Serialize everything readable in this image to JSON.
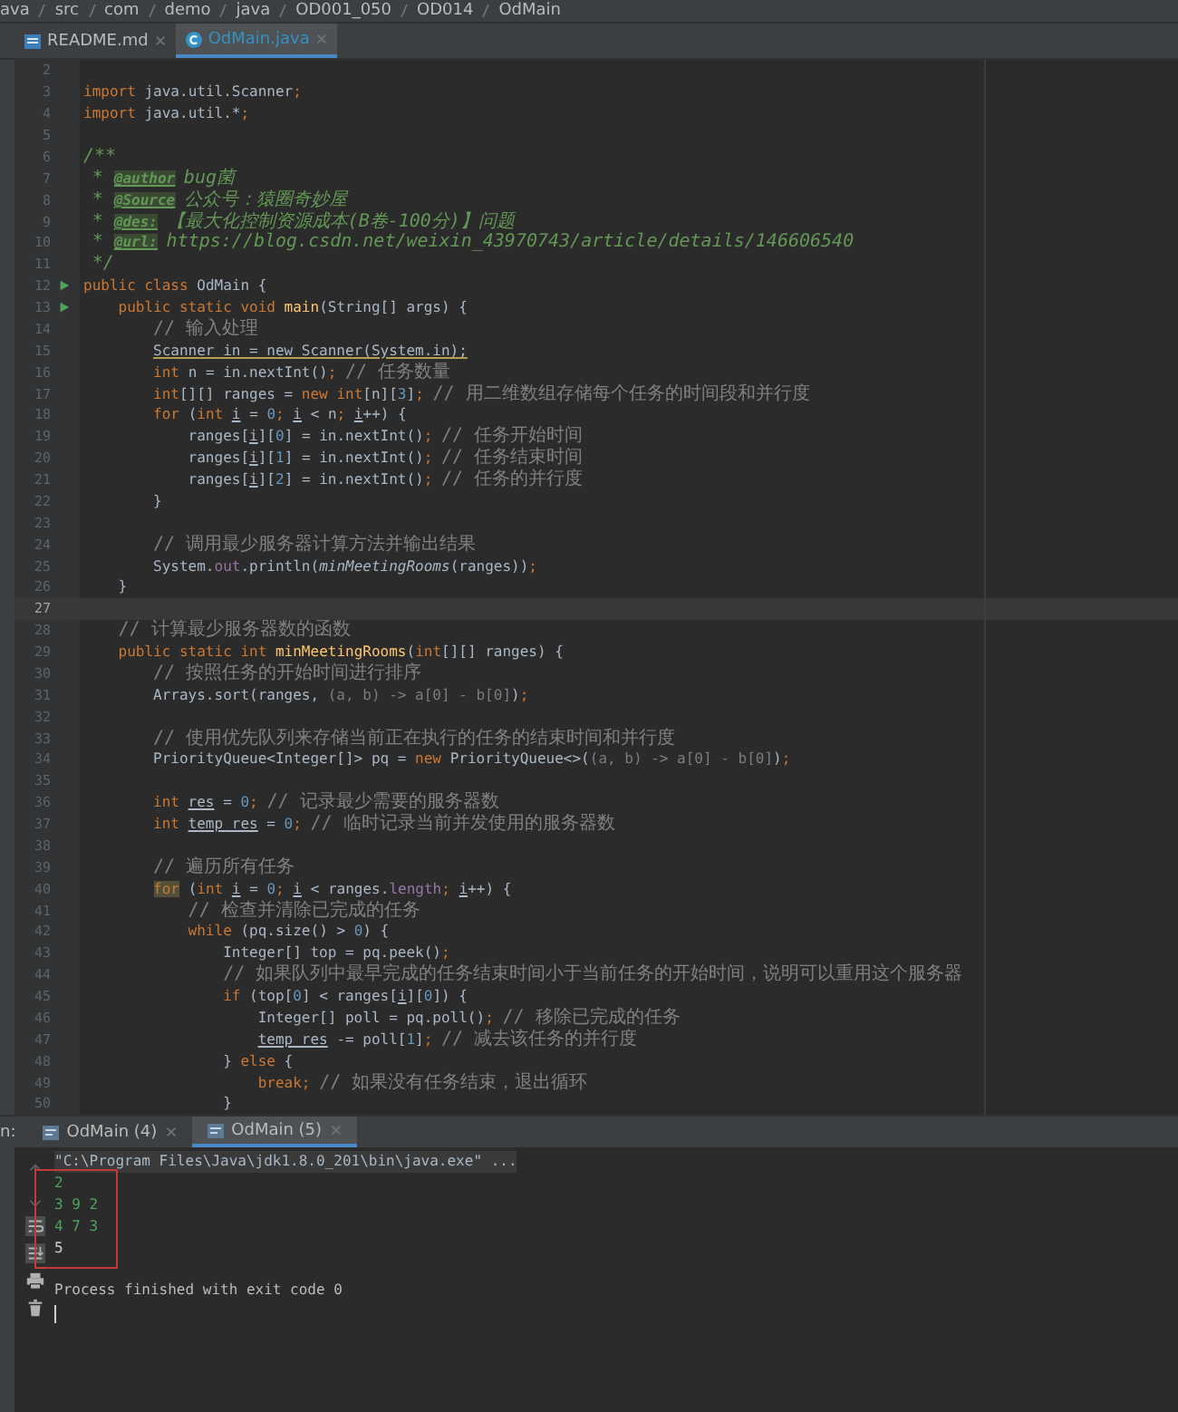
{
  "breadcrumb": [
    "ava",
    "src",
    "com",
    "demo",
    "java",
    "OD001_050",
    "OD014",
    "OdMain"
  ],
  "editor_tabs": [
    {
      "label": "README.md",
      "kind": "markdown",
      "selected": false
    },
    {
      "label": "OdMain.java",
      "kind": "java",
      "selected": true
    }
  ],
  "editor": {
    "lines": [
      {
        "number": "2",
        "current": false
      },
      {
        "number": "3",
        "current": false,
        "tokens": [
          {
            "kind": "kw",
            "text": "import"
          },
          {
            "kind": "plain",
            "text": " java.util.Scanner"
          },
          {
            "kind": "kw",
            "text": ";"
          }
        ]
      },
      {
        "number": "4",
        "current": false,
        "tokens": [
          {
            "kind": "kw",
            "text": "import"
          },
          {
            "kind": "plain",
            "text": " java.util.*"
          },
          {
            "kind": "kw",
            "text": ";"
          }
        ]
      },
      {
        "number": "5",
        "current": false
      },
      {
        "number": "6",
        "current": false,
        "tokens": [
          {
            "kind": "doc",
            "text": "/**"
          }
        ]
      },
      {
        "number": "7",
        "current": false,
        "tokens": [
          {
            "kind": "doc",
            "text": " * "
          },
          {
            "kind": "tag",
            "text": "@author"
          },
          {
            "kind": "doc",
            "text": " bug菌"
          }
        ]
      },
      {
        "number": "8",
        "current": false,
        "tokens": [
          {
            "kind": "doc",
            "text": " * "
          },
          {
            "kind": "tag",
            "text": "@Source"
          },
          {
            "kind": "doc",
            "text": " 公众号：猿圈奇妙屋"
          }
        ]
      },
      {
        "number": "9",
        "current": false,
        "tokens": [
          {
            "kind": "doc",
            "text": " * "
          },
          {
            "kind": "tag",
            "text": "@des:"
          },
          {
            "kind": "doc",
            "text": " 【最大化控制资源成本(B卷-100分)】问题"
          }
        ]
      },
      {
        "number": "10",
        "current": false,
        "tokens": [
          {
            "kind": "doc",
            "text": " * "
          },
          {
            "kind": "tag",
            "text": "@url:"
          },
          {
            "kind": "doc",
            "text": " https://blog.csdn.net/weixin_43970743/article/details/146606540"
          }
        ]
      },
      {
        "number": "11",
        "current": false,
        "tokens": [
          {
            "kind": "doc",
            "text": " */"
          }
        ]
      },
      {
        "number": "12",
        "current": false,
        "run": true,
        "tokens": [
          {
            "kind": "kw",
            "text": "public class"
          },
          {
            "kind": "plain",
            "text": " OdMain {"
          }
        ]
      },
      {
        "number": "13",
        "current": false,
        "run": true,
        "tokens": [
          {
            "kind": "kw",
            "text": "    public static void"
          },
          {
            "kind": "fn",
            "text": " main"
          },
          {
            "kind": "plain",
            "text": "(String[] args) {"
          }
        ]
      },
      {
        "number": "14",
        "current": false,
        "tokens": [
          {
            "kind": "comment",
            "text": "        // 输入处理"
          }
        ]
      },
      {
        "number": "15",
        "current": false,
        "tokens": [
          {
            "kind": "warn",
            "text": "        Scanner in = new Scanner(System.in);"
          }
        ]
      },
      {
        "number": "16",
        "current": false,
        "tokens": [
          {
            "kind": "kw",
            "text": "        int"
          },
          {
            "kind": "plain",
            "text": " n = in.nextInt()"
          },
          {
            "kind": "kw",
            "text": ";"
          },
          {
            "kind": "comment",
            "text": " // 任务数量"
          }
        ]
      },
      {
        "number": "17",
        "current": false,
        "tokens": [
          {
            "kind": "kw",
            "text": "        int"
          },
          {
            "kind": "plain",
            "text": "[][] ranges = "
          },
          {
            "kind": "kw",
            "text": "new int"
          },
          {
            "kind": "plain",
            "text": "[n]["
          },
          {
            "kind": "num",
            "text": "3"
          },
          {
            "kind": "plain",
            "text": "]"
          },
          {
            "kind": "kw",
            "text": ";"
          },
          {
            "kind": "comment",
            "text": " // 用二维数组存储每个任务的时间段和并行度"
          }
        ]
      },
      {
        "number": "18",
        "current": false,
        "tokens": [
          {
            "kind": "kw",
            "text": "        for"
          },
          {
            "kind": "plain",
            "text": " ("
          },
          {
            "kind": "kw",
            "text": "int "
          },
          {
            "kind": "var",
            "text": "i"
          },
          {
            "kind": "plain",
            "text": " = "
          },
          {
            "kind": "num",
            "text": "0"
          },
          {
            "kind": "kw",
            "text": "; "
          },
          {
            "kind": "var",
            "text": "i"
          },
          {
            "kind": "plain",
            "text": " < n"
          },
          {
            "kind": "kw",
            "text": "; "
          },
          {
            "kind": "var",
            "text": "i"
          },
          {
            "kind": "plain",
            "text": "++) {"
          }
        ]
      },
      {
        "number": "19",
        "current": false,
        "tokens": [
          {
            "kind": "plain",
            "text": "            ranges["
          },
          {
            "kind": "var",
            "text": "i"
          },
          {
            "kind": "plain",
            "text": "]["
          },
          {
            "kind": "num",
            "text": "0"
          },
          {
            "kind": "plain",
            "text": "] = in.nextInt()"
          },
          {
            "kind": "kw",
            "text": ";"
          },
          {
            "kind": "comment",
            "text": " // 任务开始时间"
          }
        ]
      },
      {
        "number": "20",
        "current": false,
        "tokens": [
          {
            "kind": "plain",
            "text": "            ranges["
          },
          {
            "kind": "var",
            "text": "i"
          },
          {
            "kind": "plain",
            "text": "]["
          },
          {
            "kind": "num",
            "text": "1"
          },
          {
            "kind": "plain",
            "text": "] = in.nextInt()"
          },
          {
            "kind": "kw",
            "text": ";"
          },
          {
            "kind": "comment",
            "text": " // 任务结束时间"
          }
        ]
      },
      {
        "number": "21",
        "current": false,
        "tokens": [
          {
            "kind": "plain",
            "text": "            ranges["
          },
          {
            "kind": "var",
            "text": "i"
          },
          {
            "kind": "plain",
            "text": "]["
          },
          {
            "kind": "num",
            "text": "2"
          },
          {
            "kind": "plain",
            "text": "] = in.nextInt()"
          },
          {
            "kind": "kw",
            "text": ";"
          },
          {
            "kind": "comment",
            "text": " // 任务的并行度"
          }
        ]
      },
      {
        "number": "22",
        "current": false,
        "tokens": [
          {
            "kind": "plain",
            "text": "        }"
          }
        ]
      },
      {
        "number": "23",
        "current": false
      },
      {
        "number": "24",
        "current": false,
        "tokens": [
          {
            "kind": "comment",
            "text": "        // 调用最少服务器计算方法并输出结果"
          }
        ]
      },
      {
        "number": "25",
        "current": false,
        "tokens": [
          {
            "kind": "plain",
            "text": "        System."
          },
          {
            "kind": "field",
            "text": "out"
          },
          {
            "kind": "plain",
            "text": ".println("
          },
          {
            "kind": "italic",
            "text": "minMeetingRooms"
          },
          {
            "kind": "plain",
            "text": "(ranges))"
          },
          {
            "kind": "kw",
            "text": ";"
          }
        ]
      },
      {
        "number": "26",
        "current": false,
        "tokens": [
          {
            "kind": "plain",
            "text": "    }"
          }
        ]
      },
      {
        "number": "27",
        "current": true
      },
      {
        "number": "28",
        "current": false,
        "tokens": [
          {
            "kind": "comment",
            "text": "    // 计算最少服务器数的函数"
          }
        ]
      },
      {
        "number": "29",
        "current": false,
        "tokens": [
          {
            "kind": "kw",
            "text": "    public static int"
          },
          {
            "kind": "fn",
            "text": " minMeetingRooms"
          },
          {
            "kind": "plain",
            "text": "("
          },
          {
            "kind": "kw",
            "text": "int"
          },
          {
            "kind": "plain",
            "text": "[][] ranges) {"
          }
        ]
      },
      {
        "number": "30",
        "current": false,
        "tokens": [
          {
            "kind": "comment",
            "text": "        // 按照任务的开始时间进行排序"
          }
        ]
      },
      {
        "number": "31",
        "current": false,
        "tokens": [
          {
            "kind": "plain",
            "text": "        Arrays.sort(ranges, "
          },
          {
            "kind": "lambda",
            "text": "(a, b) -> a[0] - b[0]"
          },
          {
            "kind": "plain",
            "text": ")"
          },
          {
            "kind": "kw",
            "text": ";"
          }
        ]
      },
      {
        "number": "32",
        "current": false
      },
      {
        "number": "33",
        "current": false,
        "tokens": [
          {
            "kind": "comment",
            "text": "        // 使用优先队列来存储当前正在执行的任务的结束时间和并行度"
          }
        ]
      },
      {
        "number": "34",
        "current": false,
        "tokens": [
          {
            "kind": "plain",
            "text": "        PriorityQueue<Integer[]> pq = "
          },
          {
            "kind": "kw",
            "text": "new"
          },
          {
            "kind": "plain",
            "text": " PriorityQueue<>("
          },
          {
            "kind": "lambda",
            "text": "(a, b) -> a[0] - b[0]"
          },
          {
            "kind": "plain",
            "text": ")"
          },
          {
            "kind": "kw",
            "text": ";"
          }
        ]
      },
      {
        "number": "35",
        "current": false
      },
      {
        "number": "36",
        "current": false,
        "tokens": [
          {
            "kind": "kw",
            "text": "        int "
          },
          {
            "kind": "var",
            "text": "res"
          },
          {
            "kind": "plain",
            "text": " = "
          },
          {
            "kind": "num",
            "text": "0"
          },
          {
            "kind": "kw",
            "text": ";"
          },
          {
            "kind": "comment",
            "text": " // 记录最少需要的服务器数"
          }
        ]
      },
      {
        "number": "37",
        "current": false,
        "tokens": [
          {
            "kind": "kw",
            "text": "        int "
          },
          {
            "kind": "var",
            "text": "temp_res"
          },
          {
            "kind": "plain",
            "text": " = "
          },
          {
            "kind": "num",
            "text": "0"
          },
          {
            "kind": "kw",
            "text": ";"
          },
          {
            "kind": "comment",
            "text": " // 临时记录当前并发使用的服务器数"
          }
        ]
      },
      {
        "number": "38",
        "current": false
      },
      {
        "number": "39",
        "current": false,
        "tokens": [
          {
            "kind": "comment",
            "text": "        // 遍历所有任务"
          }
        ]
      },
      {
        "number": "40",
        "current": false,
        "tokens": [
          {
            "kind": "kwmark",
            "text": "        for"
          },
          {
            "kind": "plain",
            "text": " ("
          },
          {
            "kind": "kw",
            "text": "int "
          },
          {
            "kind": "var",
            "text": "i"
          },
          {
            "kind": "plain",
            "text": " = "
          },
          {
            "kind": "num",
            "text": "0"
          },
          {
            "kind": "kw",
            "text": "; "
          },
          {
            "kind": "var",
            "text": "i"
          },
          {
            "kind": "plain",
            "text": " < ranges."
          },
          {
            "kind": "field",
            "text": "length"
          },
          {
            "kind": "kw",
            "text": "; "
          },
          {
            "kind": "var",
            "text": "i"
          },
          {
            "kind": "plain",
            "text": "++) {"
          }
        ]
      },
      {
        "number": "41",
        "current": false,
        "tokens": [
          {
            "kind": "comment",
            "text": "            // 检查并清除已完成的任务"
          }
        ]
      },
      {
        "number": "42",
        "current": false,
        "tokens": [
          {
            "kind": "kw",
            "text": "            while"
          },
          {
            "kind": "plain",
            "text": " (pq.size() > "
          },
          {
            "kind": "num",
            "text": "0"
          },
          {
            "kind": "plain",
            "text": ") {"
          }
        ]
      },
      {
        "number": "43",
        "current": false,
        "tokens": [
          {
            "kind": "plain",
            "text": "                Integer[] top = pq.peek()"
          },
          {
            "kind": "kw",
            "text": ";"
          }
        ]
      },
      {
        "number": "44",
        "current": false,
        "tokens": [
          {
            "kind": "comment",
            "text": "                // 如果队列中最早完成的任务结束时间小于当前任务的开始时间，说明可以重用这个服务器"
          }
        ]
      },
      {
        "number": "45",
        "current": false,
        "tokens": [
          {
            "kind": "kw",
            "text": "                if"
          },
          {
            "kind": "plain",
            "text": " (top["
          },
          {
            "kind": "num",
            "text": "0"
          },
          {
            "kind": "plain",
            "text": "] < ranges["
          },
          {
            "kind": "var",
            "text": "i"
          },
          {
            "kind": "plain",
            "text": "]["
          },
          {
            "kind": "num",
            "text": "0"
          },
          {
            "kind": "plain",
            "text": "]) {"
          }
        ]
      },
      {
        "number": "46",
        "current": false,
        "tokens": [
          {
            "kind": "plain",
            "text": "                    Integer[] poll = pq.poll()"
          },
          {
            "kind": "kw",
            "text": ";"
          },
          {
            "kind": "comment",
            "text": " // 移除已完成的任务"
          }
        ]
      },
      {
        "number": "47",
        "current": false,
        "tokens": [
          {
            "kind": "var",
            "text": "                    temp_res"
          },
          {
            "kind": "plain",
            "text": " -= poll["
          },
          {
            "kind": "num",
            "text": "1"
          },
          {
            "kind": "plain",
            "text": "]"
          },
          {
            "kind": "kw",
            "text": ";"
          },
          {
            "kind": "comment",
            "text": " // 减去该任务的并行度"
          }
        ]
      },
      {
        "number": "48",
        "current": false,
        "tokens": [
          {
            "kind": "plain",
            "text": "                } "
          },
          {
            "kind": "kw",
            "text": "else"
          },
          {
            "kind": "plain",
            "text": " {"
          }
        ]
      },
      {
        "number": "49",
        "current": false,
        "tokens": [
          {
            "kind": "kw",
            "text": "                    break;"
          },
          {
            "kind": "comment",
            "text": " // 如果没有任务结束，退出循环"
          }
        ]
      },
      {
        "number": "50",
        "current": false,
        "tokens": [
          {
            "kind": "plain",
            "text": "                }"
          }
        ]
      }
    ]
  },
  "run_panel": {
    "label": "n:",
    "tabs": [
      {
        "label": "OdMain (4)",
        "selected": false
      },
      {
        "label": "OdMain (5)",
        "selected": true
      }
    ],
    "console": [
      {
        "kind": "command",
        "text": "\"C:\\Program Files\\Java\\jdk1.8.0_201\\bin\\java.exe\" ..."
      },
      {
        "kind": "input",
        "text": "2"
      },
      {
        "kind": "input",
        "text": "3 9 2"
      },
      {
        "kind": "input",
        "text": "4 7 3"
      },
      {
        "kind": "output",
        "text": "5"
      },
      {
        "kind": "system",
        "text": "Process finished with exit code 0"
      }
    ]
  }
}
